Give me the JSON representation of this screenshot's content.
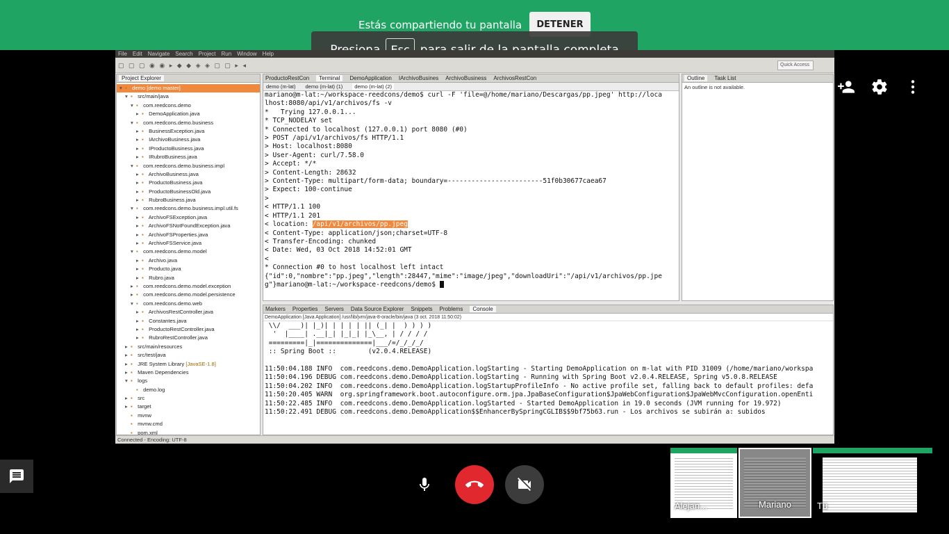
{
  "banner": {
    "share_text": "Estás compartiendo tu pantalla",
    "stop_label": "DETENER",
    "fullscreen_prefix": "Presiona",
    "fullscreen_key": "Esc",
    "fullscreen_suffix": "para salir de la pantalla completa"
  },
  "ide": {
    "menu": [
      "File",
      "Edit",
      "Navigate",
      "Search",
      "Project",
      "Run",
      "Window",
      "Help"
    ],
    "quick_access": "Quick Access",
    "explorer_title": "Project Explorer",
    "editor_tabs": [
      "ProductoRestCon",
      "Terminal",
      "DemoApplication",
      "IArchivoBusines",
      "ArchivoBusiness",
      "ArchivosRestCon"
    ],
    "terminal_tabs": [
      "demo (m-lat)",
      "demo (m-lat) (1)",
      "demo (m-lat) (2)"
    ],
    "outline_tabs": [
      "Outline",
      "Task List"
    ],
    "outline_message": "An outline is not available.",
    "console_tabs": [
      "Markers",
      "Properties",
      "Servers",
      "Data Source Explorer",
      "Snippets",
      "Problems",
      "Console"
    ],
    "console_subtitle": "DemoApplication [Java Application] /usr/lib/jvm/java-8-oracle/bin/java (3 oct. 2018 11:50:02)",
    "status": "Connected - Encoding: UTF-8",
    "tree": [
      {
        "label": "demo [demo master]",
        "indent": 0,
        "tri": "▾",
        "sel": true
      },
      {
        "label": "src/main/java",
        "indent": 1,
        "tri": "▾"
      },
      {
        "label": "com.reedcons.demo",
        "indent": 2,
        "tri": "▾"
      },
      {
        "label": "DemoApplication.java",
        "indent": 3,
        "tri": "▸"
      },
      {
        "label": "com.reedcons.demo.business",
        "indent": 2,
        "tri": "▾"
      },
      {
        "label": "BusinessException.java",
        "indent": 3,
        "tri": "▸"
      },
      {
        "label": "IArchivoBusiness.java",
        "indent": 3,
        "tri": "▸"
      },
      {
        "label": "IProductoBusiness.java",
        "indent": 3,
        "tri": "▸"
      },
      {
        "label": "IRubroBusiness.java",
        "indent": 3,
        "tri": "▸"
      },
      {
        "label": "com.reedcons.demo.business.impl",
        "indent": 2,
        "tri": "▾"
      },
      {
        "label": "ArchivoBusiness.java",
        "indent": 3,
        "tri": "▸"
      },
      {
        "label": "ProductoBusiness.java",
        "indent": 3,
        "tri": "▸"
      },
      {
        "label": "ProductoBusinessOld.java",
        "indent": 3,
        "tri": "▸"
      },
      {
        "label": "RubroBusiness.java",
        "indent": 3,
        "tri": "▸"
      },
      {
        "label": "com.reedcons.demo.business.impl.util.fs",
        "indent": 2,
        "tri": "▾"
      },
      {
        "label": "ArchivoFSException.java",
        "indent": 3,
        "tri": "▸"
      },
      {
        "label": "ArchivoFSNotFoundException.java",
        "indent": 3,
        "tri": "▸"
      },
      {
        "label": "ArchivoFSProperties.java",
        "indent": 3,
        "tri": "▸"
      },
      {
        "label": "ArchivoFSService.java",
        "indent": 3,
        "tri": "▸"
      },
      {
        "label": "com.reedcons.demo.model",
        "indent": 2,
        "tri": "▾"
      },
      {
        "label": "Archivo.java",
        "indent": 3,
        "tri": "▸"
      },
      {
        "label": "Producto.java",
        "indent": 3,
        "tri": "▸"
      },
      {
        "label": "Rubro.java",
        "indent": 3,
        "tri": "▸"
      },
      {
        "label": "com.reedcons.demo.model.exception",
        "indent": 2,
        "tri": "▸"
      },
      {
        "label": "com.reedcons.demo.model.persistence",
        "indent": 2,
        "tri": "▸"
      },
      {
        "label": "com.reedcons.demo.web",
        "indent": 2,
        "tri": "▾"
      },
      {
        "label": "ArchivosRestController.java",
        "indent": 3,
        "tri": "▸"
      },
      {
        "label": "Constantes.java",
        "indent": 3,
        "tri": "▸"
      },
      {
        "label": "ProductoRestController.java",
        "indent": 3,
        "tri": "▸"
      },
      {
        "label": "RubroRestController.java",
        "indent": 3,
        "tri": "▸"
      },
      {
        "label": "src/main/resources",
        "indent": 1,
        "tri": "▸"
      },
      {
        "label": "src/test/java",
        "indent": 1,
        "tri": "▸"
      },
      {
        "label": "JRE System Library",
        "lib": "[JavaSE-1.8]",
        "indent": 1,
        "tri": "▸"
      },
      {
        "label": "Maven Dependencies",
        "indent": 1,
        "tri": "▸"
      },
      {
        "label": "logs",
        "indent": 1,
        "tri": "▾"
      },
      {
        "label": "demo.log",
        "indent": 2,
        "tri": ""
      },
      {
        "label": "src",
        "indent": 1,
        "tri": "▸"
      },
      {
        "label": "target",
        "indent": 1,
        "tri": "▸"
      },
      {
        "label": "mvnw",
        "indent": 1,
        "tri": ""
      },
      {
        "label": "mvnw.cmd",
        "indent": 1,
        "tri": ""
      },
      {
        "label": "pom.xml",
        "indent": 1,
        "tri": ""
      }
    ],
    "terminal_lines": [
      "mariano@m-lat:~/workspace-reedcons/demo$ curl -F 'file=@/home/mariano/Descargas/pp.jpeg' http://loca",
      "lhost:8080/api/v1/archivos/fs -v",
      "*   Trying 127.0.0.1...",
      "* TCP_NODELAY set",
      "* Connected to localhost (127.0.0.1) port 8080 (#0)",
      "> POST /api/v1/archivos/fs HTTP/1.1",
      "> Host: localhost:8080",
      "> User-Agent: curl/7.58.0",
      "> Accept: */*",
      "> Content-Length: 28632",
      "> Content-Type: multipart/form-data; boundary=------------------------51f0b30677caea67",
      "> Expect: 100-continue",
      ">",
      "< HTTP/1.1 100",
      "< HTTP/1.1 201"
    ],
    "location_prefix": "< location: ",
    "location_value": "/api/v1/archivos/pp.jpeg",
    "terminal_lines_after": [
      "< Content-Type: application/json;charset=UTF-8",
      "< Transfer-Encoding: chunked",
      "< Date: Wed, 03 Oct 2018 14:52:01 GMT",
      "<",
      "* Connection #0 to host localhost left intact",
      "{\"id\":0,\"nombre\":\"pp.jpeg\",\"length\":28447,\"mime\":\"image/jpeg\",\"downloadUri\":\"/api/v1/archivos/pp.jpe",
      "g\"}mariano@m-lat:~/workspace-reedcons/demo$ "
    ],
    "console_lines": [
      " \\\\/  ___)| |_)| | | | | || (_| |  ) ) ) )",
      "  '  |____| .__|_| |_|_| |_\\__, | / / / /",
      " =========|_|==============|___/=/_/_/_/",
      " :: Spring Boot ::        (v2.0.4.RELEASE)",
      "",
      "11:50:04.188 INFO  com.reedcons.demo.DemoApplication.logStarting - Starting DemoApplication on m-lat with PID 31009 (/home/mariano/workspa",
      "11:50:04.196 DEBUG com.reedcons.demo.DemoApplication.logStarting - Running with Spring Boot v2.0.4.RELEASE, Spring v5.0.8.RELEASE",
      "11:50:04.202 INFO  com.reedcons.demo.DemoApplication.logStartupProfileInfo - No active profile set, falling back to default profiles: defa",
      "11:50:20.405 WARN  org.springframework.boot.autoconfigure.orm.jpa.JpaBaseConfiguration$JpaWebConfiguration$JpaWebMvcConfiguration.openEnti",
      "11:50:22.485 INFO  com.reedcons.demo.DemoApplication.logStarted - Started DemoApplication in 19.0 seconds (JVM running for 19.972)",
      "11:50:22.491 DEBUG com.reedcons.demo.DemoApplication$$EnhancerBySpringCGLIB$$9bf75b63.run - Los archivos se subirán a: subidos"
    ]
  },
  "participants": [
    {
      "name": "Alejan..."
    },
    {
      "name": "Mariano"
    },
    {
      "name": "Tú"
    }
  ],
  "colors": {
    "meet_green": "#1fa463",
    "end_call_red": "#e0282e",
    "highlight": "#f0883e"
  }
}
